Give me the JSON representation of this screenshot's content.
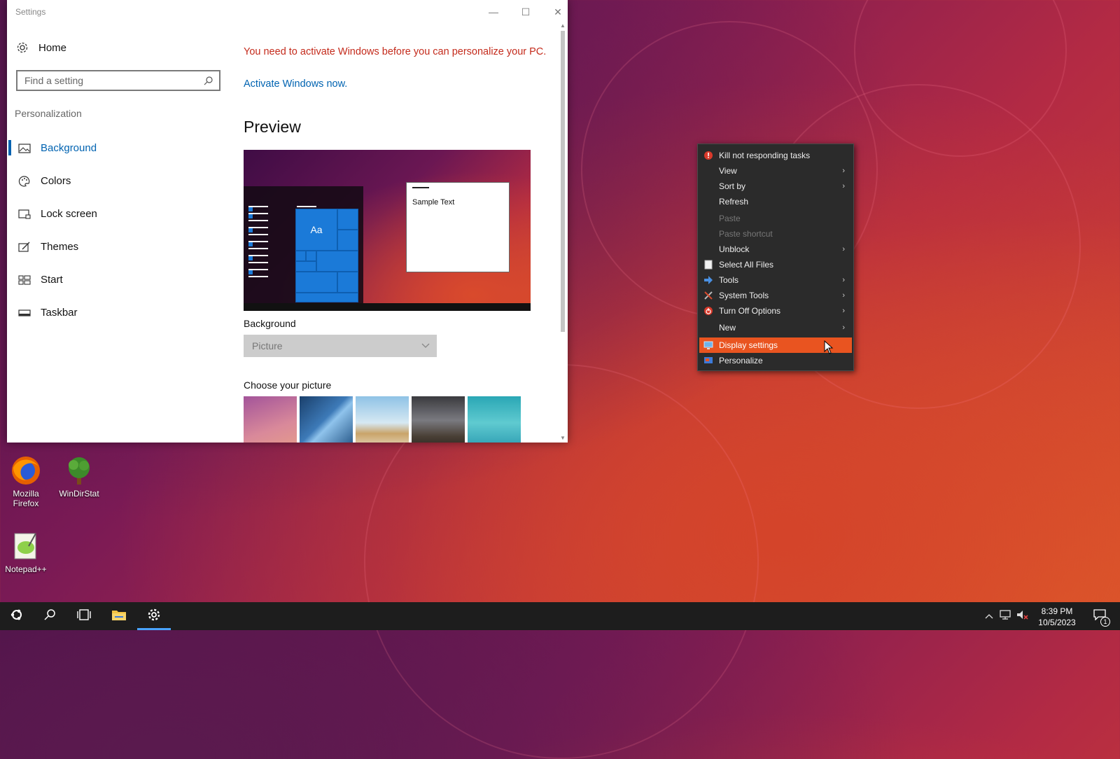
{
  "window": {
    "title": "Settings",
    "minimize_label": "—",
    "maximize_label": "☐",
    "close_label": "✕"
  },
  "sidebar": {
    "home_label": "Home",
    "search_placeholder": "Find a setting",
    "section_title": "Personalization",
    "items": [
      {
        "label": "Background",
        "icon": "picture-icon",
        "active": true
      },
      {
        "label": "Colors",
        "icon": "palette-icon"
      },
      {
        "label": "Lock screen",
        "icon": "lock-screen-icon"
      },
      {
        "label": "Themes",
        "icon": "themes-icon"
      },
      {
        "label": "Start",
        "icon": "start-icon"
      },
      {
        "label": "Taskbar",
        "icon": "taskbar-icon"
      }
    ]
  },
  "main": {
    "warning": "You need to activate Windows before you can personalize your PC.",
    "activate_link": "Activate Windows now.",
    "preview_heading": "Preview",
    "preview_tile_text": "Aa",
    "preview_sample_text": "Sample Text",
    "background_label": "Background",
    "background_value": "Picture",
    "choose_label": "Choose your picture",
    "thumbnails": [
      {
        "name": "pink-gradient-thumb"
      },
      {
        "name": "windows-blue-thumb"
      },
      {
        "name": "beach-rocks-thumb"
      },
      {
        "name": "night-sky-thumb"
      },
      {
        "name": "underwater-swimmer-thumb"
      }
    ]
  },
  "desktop_icons": [
    {
      "label": "Mozilla Firefox",
      "icon": "firefox-icon"
    },
    {
      "label": "WinDirStat",
      "icon": "windirstat-icon"
    },
    {
      "label": "Notepad++",
      "icon": "notepadpp-icon"
    }
  ],
  "context_menu": {
    "items": [
      {
        "label": "Kill not responding tasks",
        "icon": "kill-tasks-icon"
      },
      {
        "label": "View",
        "submenu": true
      },
      {
        "label": "Sort by",
        "submenu": true
      },
      {
        "label": "Refresh"
      },
      {
        "label": "Paste",
        "disabled": true
      },
      {
        "label": "Paste shortcut",
        "disabled": true
      },
      {
        "label": "Unblock",
        "submenu": true
      },
      {
        "label": "Select All Files",
        "icon": "select-all-icon"
      },
      {
        "label": "Tools",
        "icon": "tools-icon",
        "submenu": true
      },
      {
        "label": "System Tools",
        "icon": "system-tools-icon",
        "submenu": true
      },
      {
        "label": "Turn Off Options",
        "icon": "power-icon",
        "submenu": true
      },
      {
        "label": "New",
        "submenu": true
      },
      {
        "label": "Display settings",
        "icon": "display-icon",
        "highlighted": true
      },
      {
        "label": "Personalize",
        "icon": "personalize-icon"
      }
    ]
  },
  "taskbar": {
    "clock_time": "8:39 PM",
    "clock_date": "10/5/2023",
    "notification_count": "1"
  },
  "colors": {
    "accent": "#0063b1",
    "warning": "#c42b1c",
    "menu_highlight": "#e95420"
  }
}
